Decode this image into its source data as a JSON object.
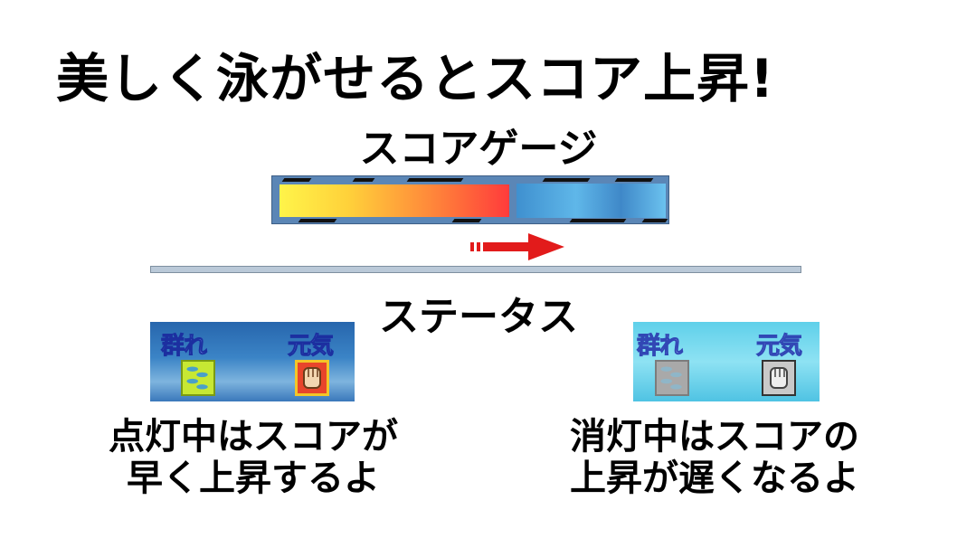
{
  "headline": "美しく泳がせるとスコア上昇!",
  "gauge": {
    "title": "スコアゲージ",
    "level_fraction": 0.6,
    "fill_colors": [
      "#fff44a",
      "#ff8a3a",
      "#ff3b3b"
    ],
    "arrow_color": "#e21b1b"
  },
  "status": {
    "title": "ステータス",
    "panels": [
      {
        "state": "on",
        "label_school": "群れ",
        "label_energy": "元気",
        "school_icon": "fish-school-icon",
        "energy_icon": "fist-icon",
        "caption_line1": "点灯中はスコアが",
        "caption_line2": "早く上昇するよ"
      },
      {
        "state": "off",
        "label_school": "群れ",
        "label_energy": "元気",
        "school_icon": "fish-school-icon",
        "energy_icon": "fist-icon",
        "caption_line1": "消灯中はスコアの",
        "caption_line2": "上昇が遅くなるよ"
      }
    ]
  }
}
